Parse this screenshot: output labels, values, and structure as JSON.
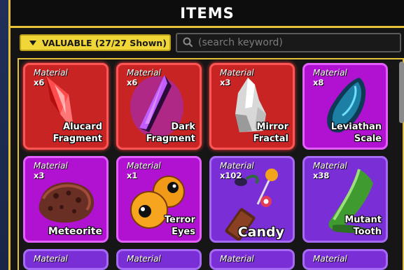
{
  "header": {
    "title": "ITEMS"
  },
  "filter": {
    "label": "VALUABLE (27/27 Shown)"
  },
  "search": {
    "placeholder": "(search keyword)"
  },
  "items": [
    {
      "category": "Material",
      "qty": "x6",
      "name_line1": "Alucard",
      "name_line2": "Fragment",
      "rarity": "red",
      "icon": "red-crystal-shard-icon"
    },
    {
      "category": "Material",
      "qty": "x6",
      "name_line1": "Dark",
      "name_line2": "Fragment",
      "rarity": "red",
      "icon": "dark-purple-shard-icon"
    },
    {
      "category": "Material",
      "qty": "x3",
      "name_line1": "Mirror",
      "name_line2": "Fractal",
      "rarity": "red",
      "icon": "silver-shard-icon"
    },
    {
      "category": "Material",
      "qty": "x8",
      "name_line1": "Leviathan",
      "name_line2": "Scale",
      "rarity": "magenta",
      "icon": "blue-scale-icon"
    },
    {
      "category": "Material",
      "qty": "x3",
      "name_line1": "",
      "name_line2": "Meteorite",
      "rarity": "magenta",
      "icon": "meteorite-rock-icon"
    },
    {
      "category": "Material",
      "qty": "x1",
      "name_line1": "Terror",
      "name_line2": "Eyes",
      "rarity": "magenta",
      "icon": "orange-eyes-icon"
    },
    {
      "category": "Material",
      "qty": "x102",
      "name_line1": "",
      "name_line2": "Candy",
      "rarity": "violet",
      "icon": "candy-pile-icon"
    },
    {
      "category": "Material",
      "qty": "x38",
      "name_line1": "Mutant",
      "name_line2": "Tooth",
      "rarity": "violet",
      "icon": "green-tooth-icon"
    }
  ],
  "partial_row": [
    {
      "category": "Material",
      "rarity": "violet"
    },
    {
      "category": "Material",
      "rarity": "violet"
    },
    {
      "category": "Material",
      "rarity": "violet"
    },
    {
      "category": "Material",
      "rarity": "violet"
    }
  ]
}
